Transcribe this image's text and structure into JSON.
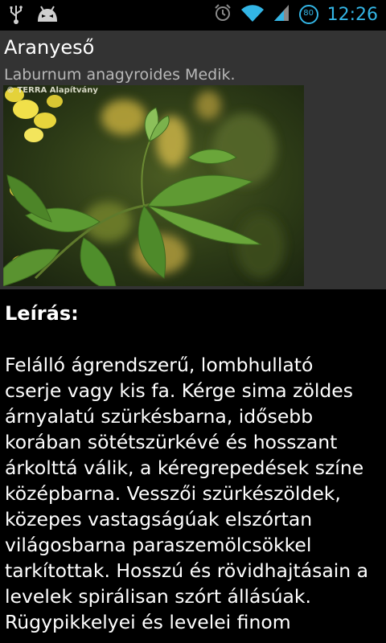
{
  "status_bar": {
    "time": "12:26",
    "battery_level": "80",
    "icons": [
      "usb-icon",
      "android-icon",
      "alarm-icon",
      "wifi-icon",
      "signal-icon",
      "battery-icon"
    ]
  },
  "plant": {
    "name": "Aranyeső",
    "latin_name": "Laburnum anagyroides Medik.",
    "image_credit": "© TERRA Alapítvány"
  },
  "description": {
    "heading": "Leírás:",
    "lines": [
      "Felálló ágrendszerű, lombhullató",
      "cserje vagy kis fa. Kérge sima zöldes",
      "árnyalatú szürkésbarna, idősebb",
      "korában sötétszürkévé és hosszant",
      "árkolttá válik, a kéregrepedések színe",
      "középbarna. Vesszői szürkészöldek,",
      "közepes vastagságúak elszórtan",
      "világosbarna paraszemölcsökkel",
      "tarkítottak. Hosszú és rövidhajtásain a",
      "levelek spirálisan szórt állásúak.",
      "Rügypikkelyei és levelei finom"
    ]
  },
  "colors": {
    "accent": "#33b5e5",
    "panel": "#333333",
    "background": "#000000"
  }
}
